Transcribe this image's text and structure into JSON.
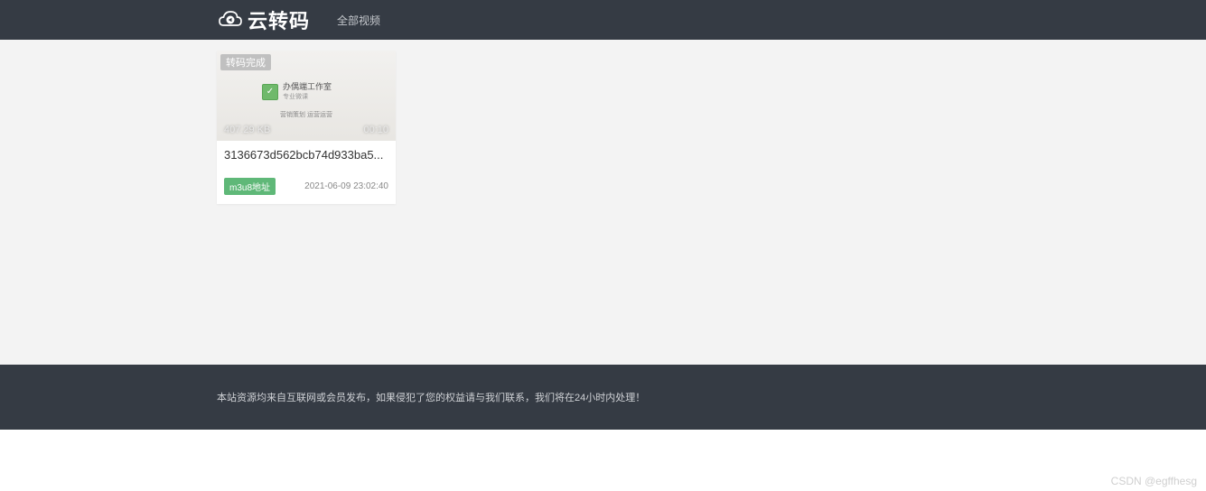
{
  "navbar": {
    "brand": "云转码",
    "link_all_videos": "全部视频"
  },
  "videos": [
    {
      "status_label": "转码完成",
      "thumb_badge": " ",
      "thumb_center_title": "办偶端工作室",
      "thumb_center_sub": "专业微课",
      "thumb_bottom_text": "营销策划  运营运营",
      "filesize": "407.29 KB",
      "duration": "00:10",
      "title": "3136673d562bcb74d933ba5...",
      "m3u8_label": "m3u8地址",
      "timestamp": "2021-06-09 23:02:40"
    }
  ],
  "footer": {
    "disclaimer": "本站资源均来自互联网或会员发布，如果侵犯了您的权益请与我们联系，我们将在24小时内处理！"
  },
  "watermark": "CSDN @egffhesg",
  "icons": {
    "cloud_logo": "cloud-logo-icon",
    "green_box": "✓"
  },
  "colors": {
    "navbar_bg": "#353b44",
    "accent_green": "#5fb878"
  }
}
